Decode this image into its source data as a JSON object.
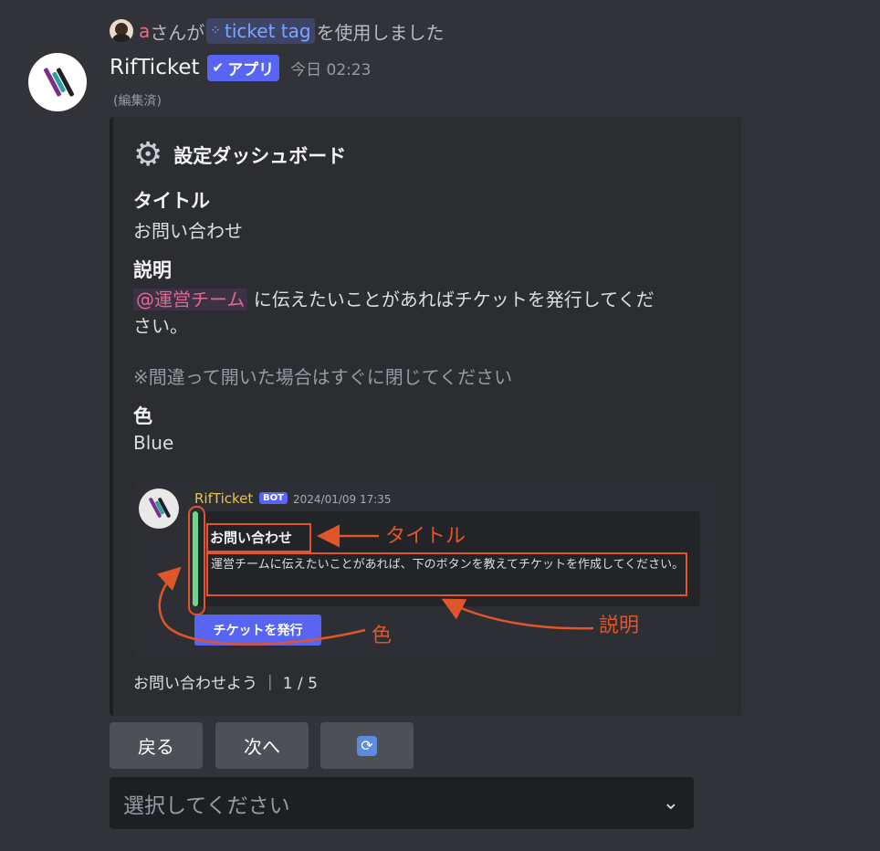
{
  "system": {
    "user": "a",
    "text_before": "さんが",
    "command": "ticket tag",
    "text_after": "を使用しました",
    "command_icon": "apps-grid-icon"
  },
  "message": {
    "author": "RifTicket",
    "badge": "アプリ",
    "timestamp": "今日 02:23",
    "edited": "(編集済)"
  },
  "embed": {
    "icon": "gear-icon",
    "author": "設定ダッシュボード",
    "fields": {
      "title_name": "タイトル",
      "title_value": "お問い合わせ",
      "desc_name": "説明",
      "desc_mention": "@運営チーム",
      "desc_line1": "に伝えたいことがあればチケットを発行してくだ",
      "desc_line2": "さい。",
      "note": "※間違って開いた場合はすぐに閉じてください",
      "color_name": "色",
      "color_value": "Blue"
    },
    "footer": "お問い合わせよう ｜ 1 / 5"
  },
  "preview": {
    "bot_name": "RifTicket",
    "bot_tag": "BOT",
    "time": "2024/01/09 17:35",
    "embed_title": "お問い合わせ",
    "embed_desc": "運営チームに伝えたいことがあれば、下のボタンを教えてチケットを作成してください。",
    "button": "チケットを発行",
    "annotations": {
      "title": "タイトル",
      "desc": "説明",
      "color": "色"
    },
    "accent_color": "#6fd58a",
    "annotation_color": "#e0552a"
  },
  "buttons": {
    "back": "戻る",
    "next": "次へ",
    "refresh_icon": "refresh-icon",
    "refresh_glyph": "🔄"
  },
  "select": {
    "placeholder": "選択してください"
  },
  "colors": {
    "background": "#313338",
    "embed_bg": "#2b2d31",
    "blurple": "#5865f2",
    "mention": "#e8668b"
  }
}
